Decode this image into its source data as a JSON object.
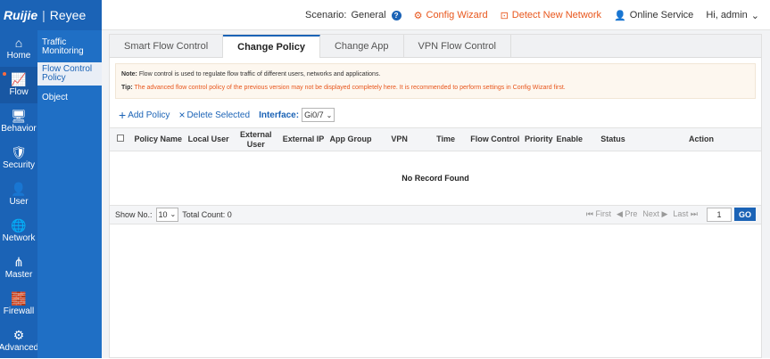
{
  "brand": {
    "logo1": "Ruijie",
    "logo2": "Reyee"
  },
  "topbar": {
    "scenario_label": "Scenario:",
    "scenario_value": "General",
    "config_wizard": "Config Wizard",
    "detect_network": "Detect New Network",
    "online_service": "Online Service",
    "user": "Hi, admin"
  },
  "sidebar": [
    {
      "label": "Home",
      "icon": "home-icon",
      "glyph": "⌂"
    },
    {
      "label": "Flow",
      "icon": "chart-icon",
      "glyph": "📈"
    },
    {
      "label": "Behavior",
      "icon": "monitor-icon",
      "glyph": "🖥"
    },
    {
      "label": "Security",
      "icon": "shield-icon",
      "glyph": "🛡"
    },
    {
      "label": "User",
      "icon": "user-icon",
      "glyph": "👤"
    },
    {
      "label": "Network",
      "icon": "globe-icon",
      "glyph": "🌐"
    },
    {
      "label": "Master",
      "icon": "hierarchy-icon",
      "glyph": "⋔"
    },
    {
      "label": "Firewall",
      "icon": "firewall-icon",
      "glyph": "🧱"
    },
    {
      "label": "Advanced",
      "icon": "gear-icon",
      "glyph": "⚙"
    }
  ],
  "subnav": {
    "traffic": "Traffic Monitoring",
    "flow_control": "Flow Control Policy",
    "object": "Object"
  },
  "tabs": [
    "Smart Flow Control",
    "Change Policy",
    "Change App",
    "VPN Flow Control"
  ],
  "notice": {
    "note_label": "Note:",
    "note_text": "Flow control is used to regulate flow traffic of different users, networks and applications.",
    "tip_label": "Tip:",
    "tip_text": "The advanced flow control policy of the previous version may not be displayed completely here. It is recommended to perform settings in Config Wizard first."
  },
  "toolbar": {
    "add": "Add Policy",
    "delete": "Delete Selected",
    "interface_label": "Interface:",
    "interface_value": "Gi0/7"
  },
  "table": {
    "columns": [
      "Policy Name",
      "Local User",
      "External User",
      "External IP",
      "App Group",
      "VPN",
      "Time",
      "Flow Control",
      "Priority",
      "Enable",
      "Status",
      "Action"
    ],
    "empty": "No Record Found"
  },
  "pager": {
    "show_label": "Show No.:",
    "show_value": "10",
    "total": "Total Count: 0",
    "first": "First",
    "prev": "Pre",
    "next": "Next",
    "last": "Last",
    "page": "1",
    "go": "GO"
  },
  "colors": {
    "brand": "#1b63b6",
    "accent": "#e8561c"
  }
}
